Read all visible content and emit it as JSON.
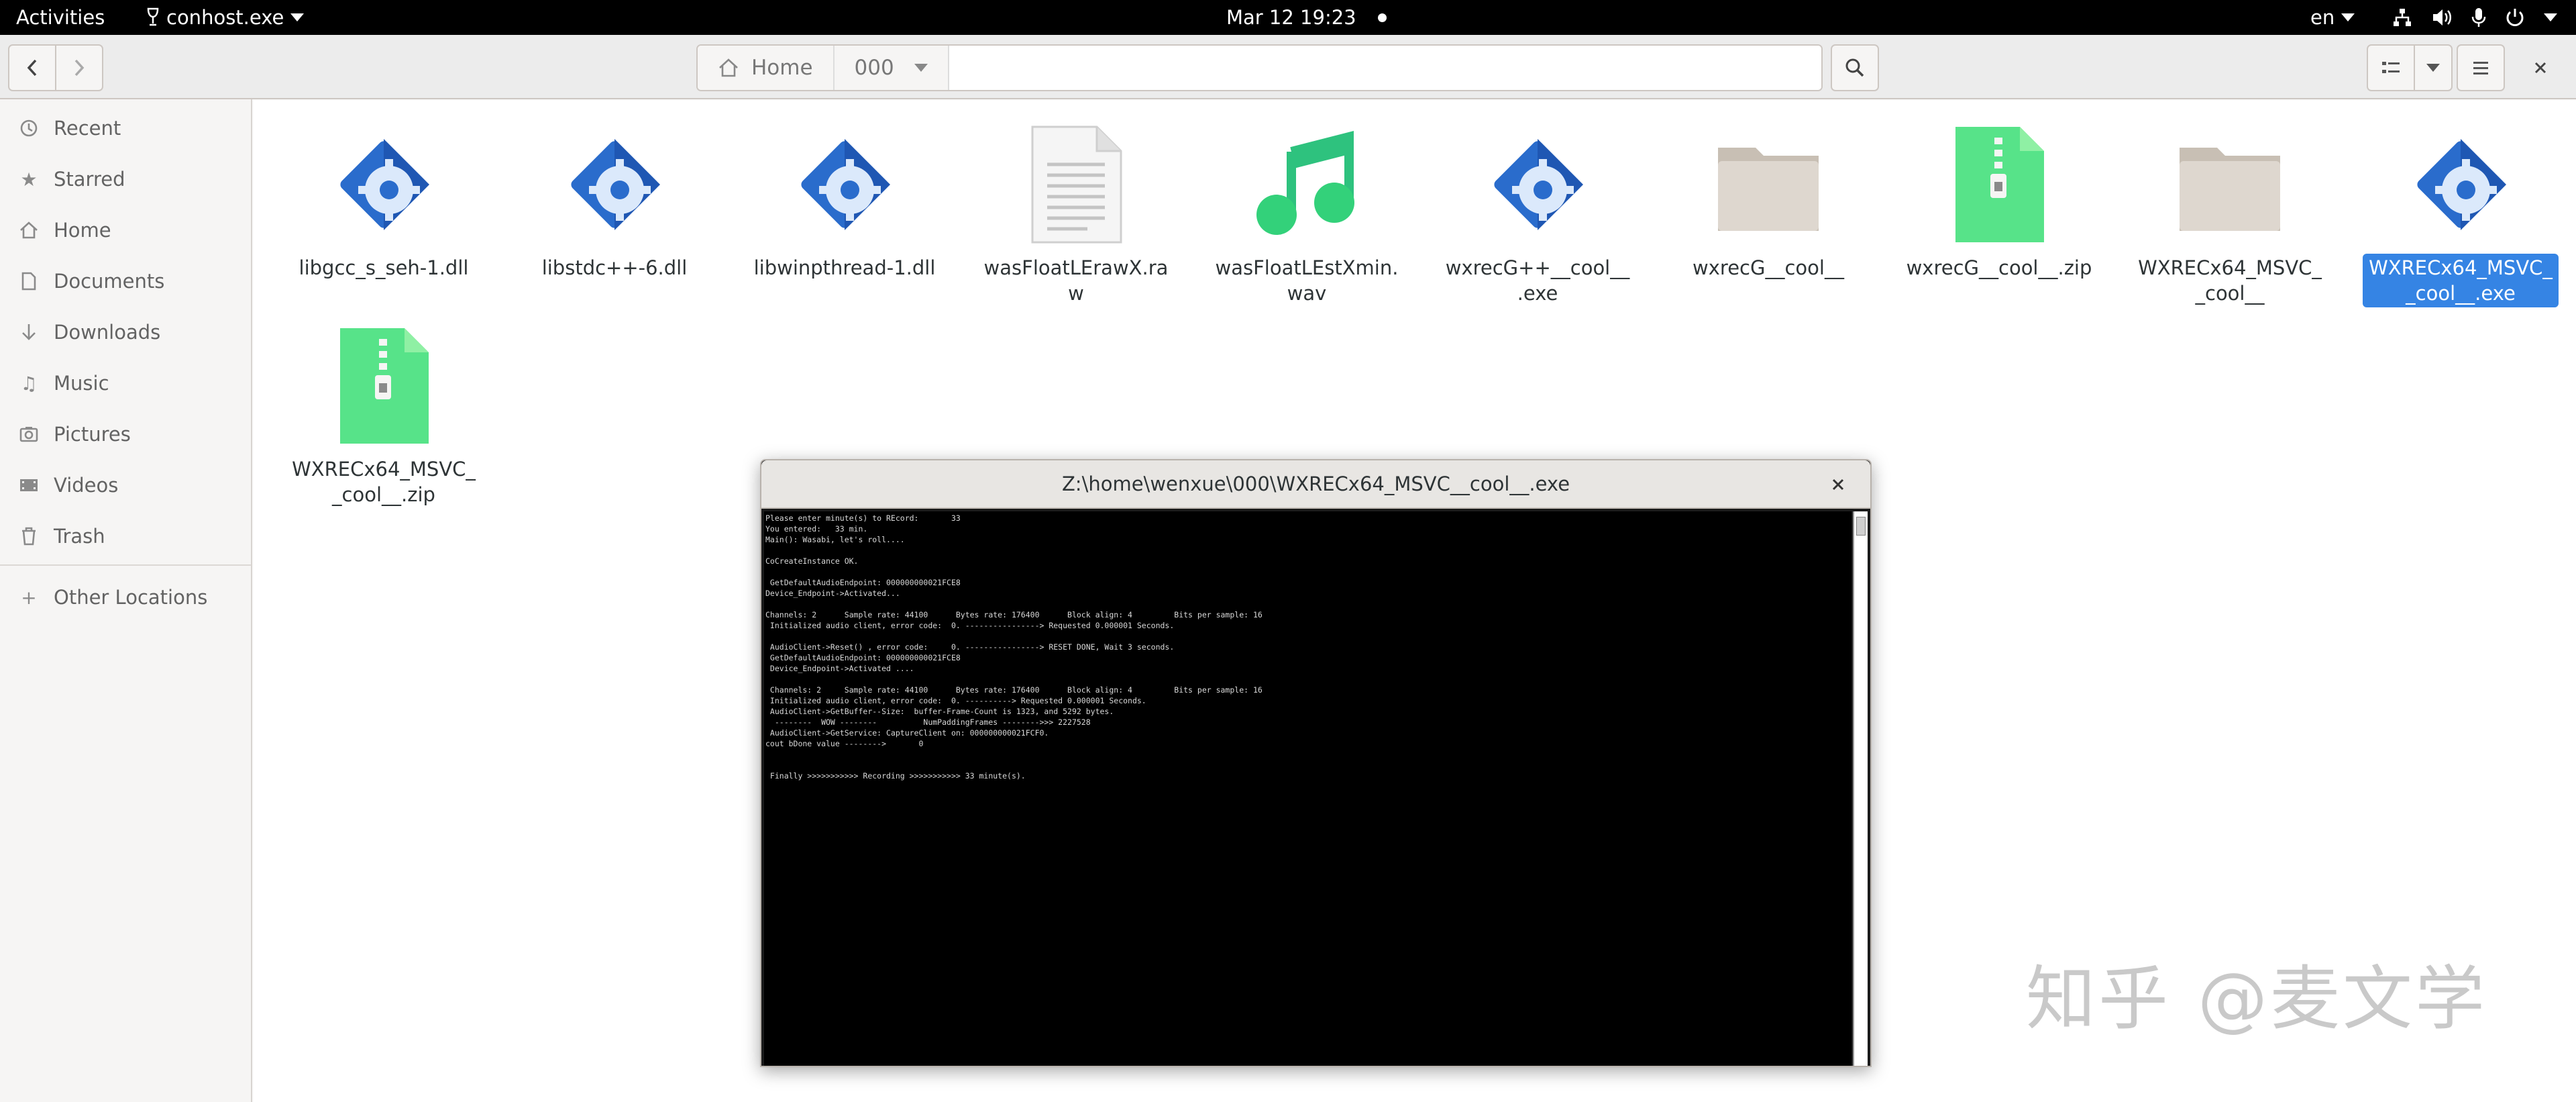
{
  "topbar": {
    "activities": "Activities",
    "app_name": "conhost.exe",
    "clock": "Mar 12  19:23",
    "language": "en"
  },
  "header": {
    "path_home": "Home",
    "path_current": "000"
  },
  "sidebar": {
    "items": [
      {
        "label": "Recent",
        "icon": "clock-icon"
      },
      {
        "label": "Starred",
        "icon": "star-icon"
      },
      {
        "label": "Home",
        "icon": "home-icon"
      },
      {
        "label": "Documents",
        "icon": "document-icon"
      },
      {
        "label": "Downloads",
        "icon": "download-icon"
      },
      {
        "label": "Music",
        "icon": "music-icon"
      },
      {
        "label": "Pictures",
        "icon": "picture-icon"
      },
      {
        "label": "Videos",
        "icon": "video-icon"
      },
      {
        "label": "Trash",
        "icon": "trash-icon"
      }
    ],
    "other_locations": "Other Locations"
  },
  "files": [
    {
      "name": "libgcc_s_seh-1.dll",
      "type": "executable"
    },
    {
      "name": "libstdc++-6.dll",
      "type": "executable"
    },
    {
      "name": "libwinpthread-1.dll",
      "type": "executable"
    },
    {
      "name": "wasFloatLErawX.raw",
      "type": "text"
    },
    {
      "name": "wasFloatLEstXmin.wav",
      "type": "audio"
    },
    {
      "name": "wxrecG++__cool__.exe",
      "type": "executable"
    },
    {
      "name": "wxrecG__cool__",
      "type": "folder"
    },
    {
      "name": "wxrecG__cool__.zip",
      "type": "archive"
    },
    {
      "name": "WXRECx64_MSVC__cool__",
      "type": "folder"
    },
    {
      "name": "WXRECx64_MSVC__cool__.exe",
      "type": "executable",
      "selected": true
    },
    {
      "name": "WXRECx64_MSVC__cool__.zip",
      "type": "archive"
    }
  ],
  "console": {
    "title": "Z:\\home\\wenxue\\000\\WXRECx64_MSVC__cool__.exe",
    "lines": [
      "Please enter minute(s) to REcord:       33",
      "You entered:   33 min.",
      "Main(): Wasabi, let's roll....",
      "",
      "CoCreateInstance OK.",
      "",
      " GetDefaultAudioEndpoint: 000000000021FCE8",
      "Device_Endpoint->Activated...",
      "",
      "Channels: 2      Sample rate: 44100      Bytes rate: 176400      Block align: 4         Bits per sample: 16",
      " Initialized audio client, error code:  0. ----------------> Requested 0.000001 Seconds.",
      "",
      " AudioClient->Reset() , error code:     0. ----------------> RESET DONE, Wait 3 seconds.",
      " GetDefaultAudioEndpoint: 000000000021FCE8",
      " Device_Endpoint->Activated ....",
      "",
      " Channels: 2     Sample rate: 44100      Bytes rate: 176400      Block align: 4         Bits per sample: 16",
      " Initialized audio client, error code:  0. ----------> Requested 0.000001 Seconds.",
      " AudioClient->GetBuffer--Size:  buffer-Frame-Count is 1323, and 5292 bytes.",
      "  --------  WOW --------          NumPaddingFrames -------->>> 2227528",
      " AudioClient->GetService: CaptureClient on: 000000000021FCF0.",
      "cout bDone value -------->       0",
      "",
      "",
      " Finally >>>>>>>>>>> Recording >>>>>>>>>>> 33 minute(s)."
    ]
  },
  "watermark": {
    "site": "知乎",
    "author": "@麦文学"
  },
  "colors": {
    "accent": "#3584e4",
    "topbar": "#000000",
    "terminal_bg": "#000000"
  }
}
